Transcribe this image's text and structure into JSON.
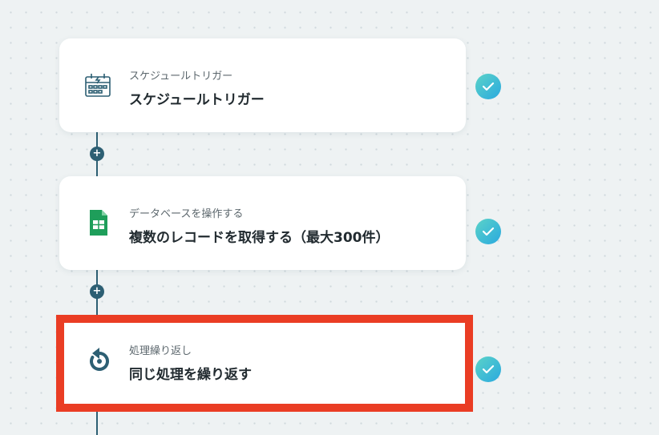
{
  "flow": {
    "steps": [
      {
        "subtitle": "スケジュールトリガー",
        "title": "スケジュールトリガー",
        "icon": "schedule-calendar-icon",
        "status": "completed"
      },
      {
        "subtitle": "データベースを操作する",
        "title": "複数のレコードを取得する（最大300件）",
        "icon": "spreadsheet-icon",
        "status": "completed"
      },
      {
        "subtitle": "処理繰り返し",
        "title": "同じ処理を繰り返す",
        "icon": "loop-icon",
        "status": "completed",
        "highlighted": true
      }
    ],
    "add_step_symbol": "+"
  },
  "colors": {
    "connector": "#2d5f73",
    "highlight_border": "#ea3d24",
    "check_gradient_start": "#5bd3c8",
    "check_gradient_end": "#2aa9df",
    "sheets_green": "#1e9e5a",
    "loop_icon": "#2d5f73"
  }
}
